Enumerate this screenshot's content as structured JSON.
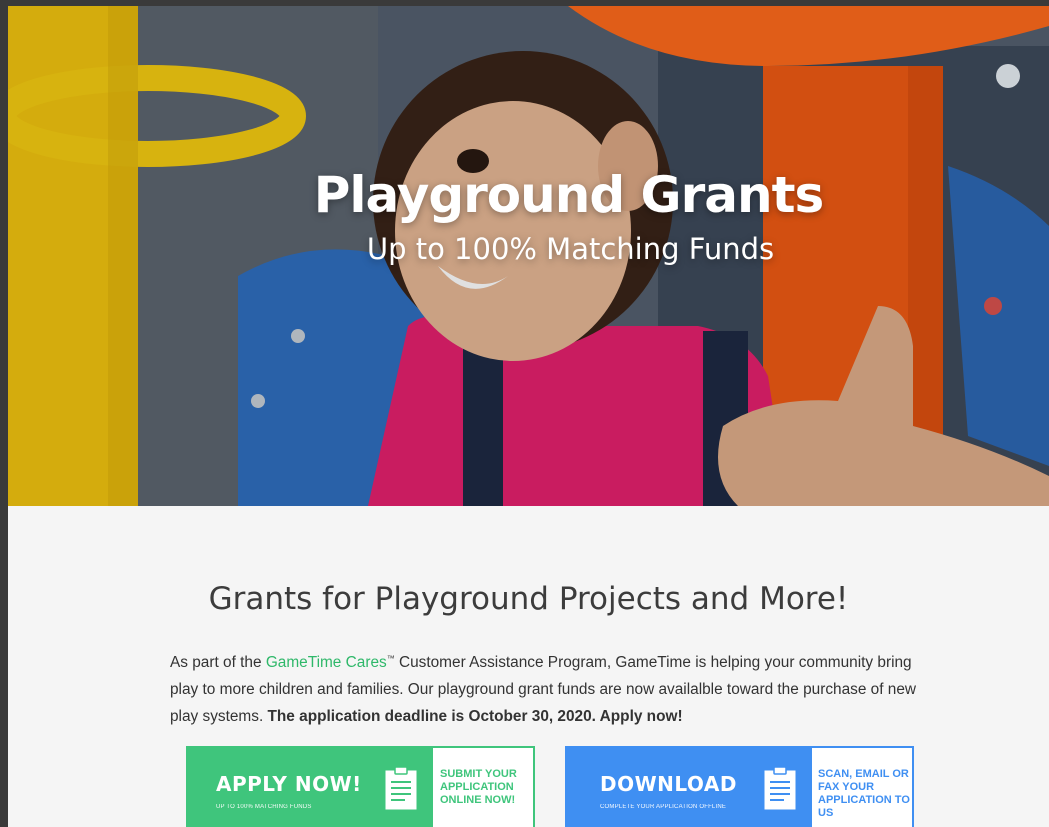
{
  "hero": {
    "title": "Playground Grants",
    "subtitle": "Up to 100% Matching Funds",
    "image_description_icon": "photo-child-on-playground"
  },
  "section": {
    "heading": "Grants for Playground Projects and More!",
    "intro_before_link": "As part of the ",
    "intro_link": "GameTime Cares",
    "intro_tm": "™",
    "intro_after_link": " Customer Assistance Program, GameTime is helping your community bring play to more children and families. Our playground grant funds are now availalble toward the purchase of new play systems. ",
    "intro_bold": "The application deadline is October 30, 2020. Apply now!"
  },
  "cta": {
    "apply": {
      "title": "APPLY NOW!",
      "subtitle": "UP TO 100% MATCHING FUNDS",
      "side_text": "SUBMIT YOUR APPLICATION ONLINE NOW!",
      "icon": "document-icon"
    },
    "download": {
      "title": "DOWNLOAD",
      "subtitle": "COMPLETE YOUR APPLICATION OFFLINE",
      "side_text": "SCAN, EMAIL OR FAX YOUR APPLICATION TO US",
      "icon": "document-icon"
    }
  },
  "colors": {
    "green": "#3fc57c",
    "blue": "#3f8ff2",
    "link_green": "#2fb86a",
    "page_bg": "#f5f5f5"
  }
}
